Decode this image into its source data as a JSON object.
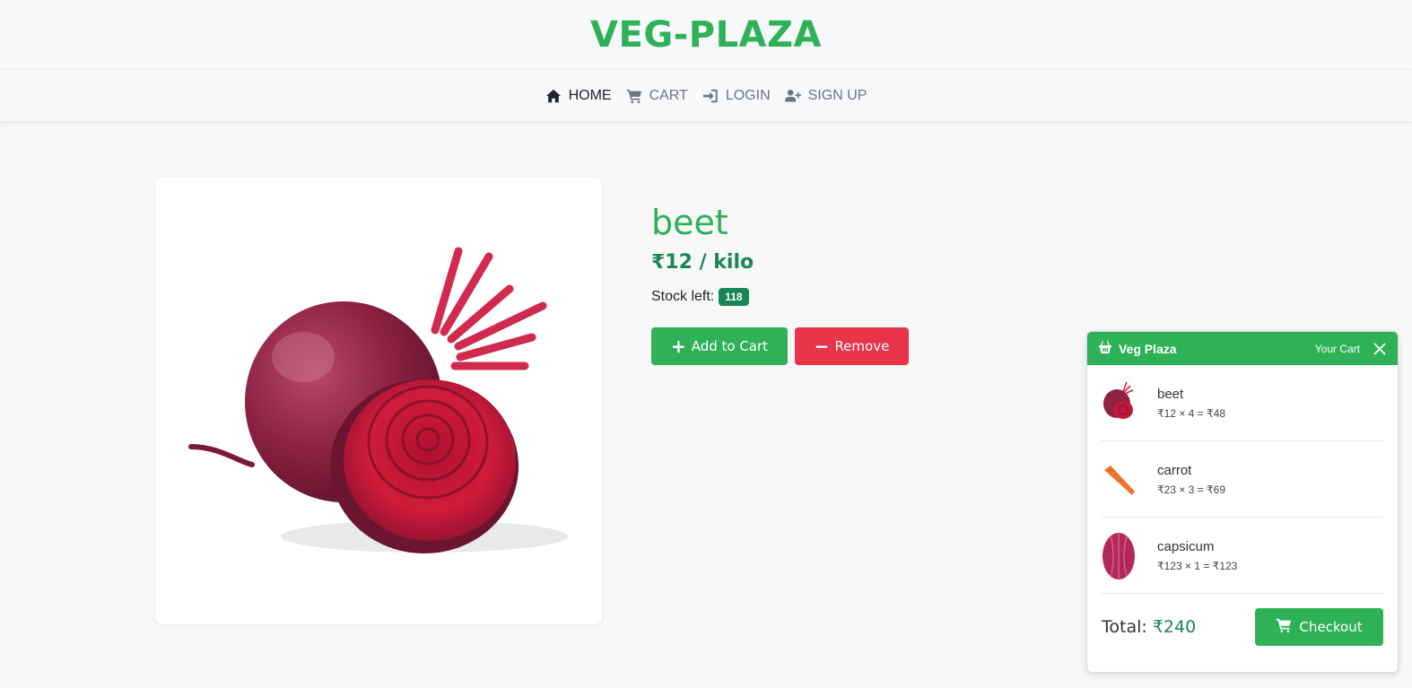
{
  "header": {
    "brand": "VEG-PLAZA"
  },
  "nav": {
    "items": [
      {
        "label": "HOME",
        "icon": "home-icon"
      },
      {
        "label": "CART",
        "icon": "cart-icon"
      },
      {
        "label": "LOGIN",
        "icon": "login-icon"
      },
      {
        "label": "SIGN UP",
        "icon": "user-plus-icon"
      }
    ]
  },
  "product": {
    "name": "beet",
    "price": "₹12 / kilo",
    "stock_label": "Stock left:",
    "stock": "118",
    "add_label": "Add to Cart",
    "remove_label": "Remove",
    "image": "beetroot-image"
  },
  "cart": {
    "brand": "Veg Plaza",
    "subtitle": "Your Cart",
    "items": [
      {
        "name": "beet",
        "calc": "₹12 × 4 = ₹48",
        "image": "beet-thumb"
      },
      {
        "name": "carrot",
        "calc": "₹23 × 3 = ₹69",
        "image": "carrot-thumb"
      },
      {
        "name": "capsicum",
        "calc": "₹123 × 1 = ₹123",
        "image": "capsicum-thumb"
      }
    ],
    "total_label": "Total:",
    "total_value": "₹240",
    "checkout_label": "Checkout"
  },
  "colors": {
    "brand_green": "#2eb157",
    "price_green": "#198754",
    "danger_red": "#e8354a"
  }
}
